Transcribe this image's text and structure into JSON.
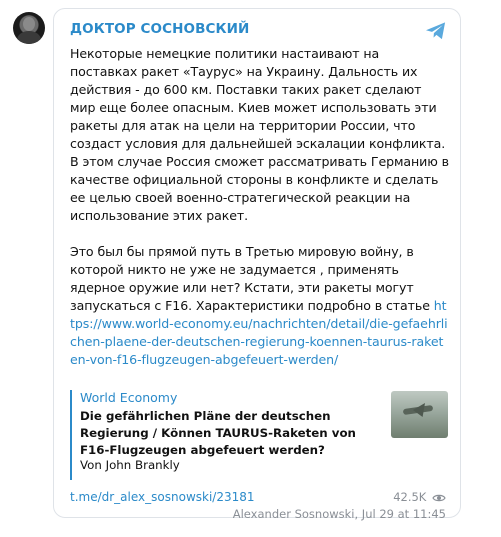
{
  "channel": {
    "name": "ДОКТОР СОСНОВСКИЙ",
    "avatar_icon": "portrait-avatar",
    "brand_icon": "telegram-icon",
    "accent_color": "#2b8ac9"
  },
  "post": {
    "paragraph1": "Некоторые немецкие политики настаивают на поставках ракет «Таурус» на Украину. Дальность их действия - до 600 км. Поставки таких ракет сделают мир еще более опасным. Киев может использовать эти ракеты для атак на цели на территории России, что создаст условия для дальнейшей эскалации конфликта. В этом случае Россия сможет рассматривать Германию в качестве официальной стороны в конфликте и сделать ее целью своей военно-стратегической реакции на использование этих ракет.",
    "paragraph2": "Это был бы прямой путь в Третью мировую войну, в которой никто не уже не задумается , применять ядерное оружие или нет? Кстати, эти ракеты могут запускаться с F16. Характеристики подробно в статье",
    "link": "https://www.world-economy.eu/nachrichten/detail/die-gefaehrlichen-plaene-der-deutschen-regierung-koennen-taurus-raketen-von-f16-flugzeugen-abgefeuert-werden/"
  },
  "preview": {
    "site": "World Economy",
    "title": "Die gefährlichen Pläne der deutschen Regierung / Können TAURUS-Raketen von F16-Flugzeugen abgefeuert werden?",
    "author": "Von John Brankly"
  },
  "footer": {
    "post_link": "t.me/dr_alex_sosnowski/23181",
    "views": "42.5K",
    "views_icon": "eye-icon",
    "author_date": "Alexander Sosnowski, Jul 29 at",
    "time": "11:45"
  }
}
